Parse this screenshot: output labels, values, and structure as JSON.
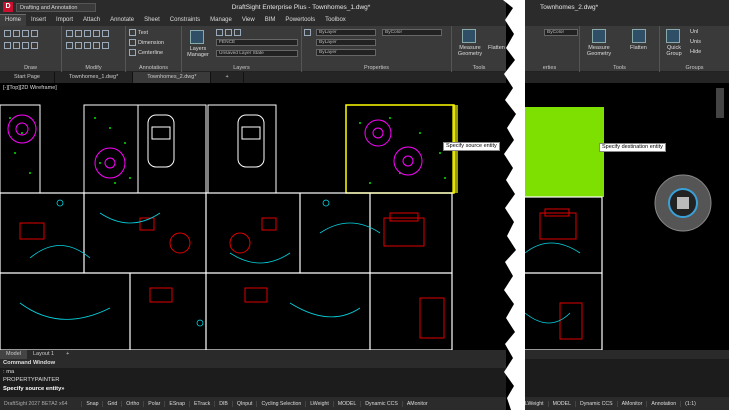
{
  "left_window": {
    "workspace": "Drafting and Annotation",
    "title": "DraftSight Enterprise Plus - Townhomes_1.dwg*",
    "menu": [
      "Home",
      "Insert",
      "Import",
      "Attach",
      "Annotate",
      "Sheet",
      "Constraints",
      "Manage",
      "View",
      "BIM",
      "Powertools",
      "Toolbox"
    ],
    "ribbon_groups": {
      "draw": "Draw",
      "modify": "Modify",
      "annotations": "Annotations",
      "layers": "Layers",
      "properties": "Properties",
      "tools": "Tools"
    },
    "ribbon_items": {
      "text": "Text",
      "dimension": "Dimension",
      "centerline": "Centerline",
      "layers_manager": "Layers Manager",
      "layer_combo": "FENCE",
      "layer_state_combo": "Unsaved Layer State",
      "bylayer_1": "ByLayer",
      "bylayer_2": "ByLayer",
      "bylayer_3": "ByLayer",
      "bycolor": "ByColor",
      "measure_geometry": "Measure Geometry",
      "flatten": "Flatten"
    },
    "doc_tabs": [
      "Start Page",
      "Townhomes_1.dwg*",
      "Townhomes_2.dwg*"
    ],
    "viewport_label": "[-][Top][2D Wireframe]",
    "tooltip": "Specify source entity",
    "layout_tabs": [
      "Model",
      "Layout 1"
    ],
    "command_window": {
      "header": "Command Window",
      "lines": [
        ": ma",
        "PROPERTYPAINTER",
        "Specify source entity»"
      ]
    },
    "status": {
      "version": "DraftSight 2027 BETA2 x64",
      "items": [
        "Snap",
        "Grid",
        "Ortho",
        "Polar",
        "ESnap",
        "ETrack",
        "DIB",
        "QInput",
        "Cycling Selection",
        "LWeight",
        "MODEL",
        "Dynamic CCS",
        "AMonitor"
      ]
    }
  },
  "right_window": {
    "title": "Townhomes_2.dwg*",
    "ribbon_groups": {
      "properties": "erties",
      "tools": "Tools",
      "groups": "Groups"
    },
    "ribbon_items": {
      "bycolor": "ByColor",
      "measure_geometry": "Measure Geometry",
      "flatten": "Flatten",
      "quick_group": "Quick Group",
      "unlist": "Unl",
      "unisolate": "Unis",
      "hide": "Hide"
    },
    "tooltip": "Specify destination entity",
    "status": {
      "items": [
        "LWeight",
        "MODEL",
        "Dynamic CCS",
        "AMonitor",
        "Annotation",
        "(1:1)"
      ]
    }
  },
  "colors": {
    "fill_green": "#7ee000",
    "plan_white": "#ffffff",
    "plan_red": "#e00000",
    "plan_cyan": "#00d8e6",
    "plan_magenta": "#ff00ff",
    "plan_green": "#00e000",
    "plan_yellow": "#ffff00"
  }
}
